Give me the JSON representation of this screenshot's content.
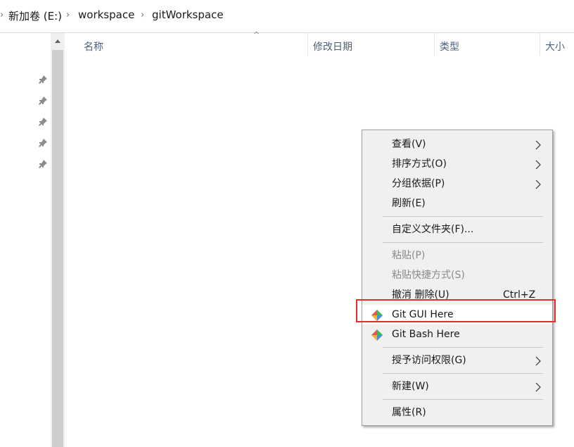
{
  "breadcrumb": {
    "items": [
      "新加卷 (E:)",
      "workspace",
      "gitWorkspace"
    ]
  },
  "columns": {
    "name": "名称",
    "modified": "修改日期",
    "type": "类型",
    "size": "大小"
  },
  "context_menu": {
    "view": "查看(V)",
    "sort_by": "排序方式(O)",
    "group_by": "分组依据(P)",
    "refresh": "刷新(E)",
    "customize": "自定义文件夹(F)...",
    "paste": "粘贴(P)",
    "paste_shortcut": "粘贴快捷方式(S)",
    "undo_delete": "撤消 删除(U)",
    "undo_shortcut": "Ctrl+Z",
    "git_gui": "Git GUI Here",
    "git_bash": "Git Bash Here",
    "give_access": "授予访问权限(G)",
    "new": "新建(W)",
    "properties": "属性(R)"
  },
  "colors": {
    "highlight_border": "#e0302e",
    "menu_bg": "#f0f0f0",
    "column_header_text": "#4c607a"
  }
}
